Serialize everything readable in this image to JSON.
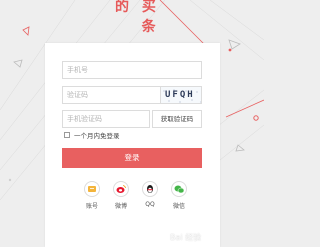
{
  "header": {
    "title_fragment": "的 买\n   条"
  },
  "form": {
    "phone_placeholder": "手机号",
    "code_placeholder": "验证码",
    "captcha_text": "UFQH",
    "sms_placeholder": "手机验证码",
    "sms_button": "获取验证码",
    "remember_label": "一个月内免登录",
    "login_button": "登录"
  },
  "socials": [
    {
      "label": "账号",
      "icon": "account-icon",
      "color": "#f3b43b"
    },
    {
      "label": "微博",
      "icon": "weibo-icon",
      "color": "#e6162d"
    },
    {
      "label": "QQ",
      "icon": "qq-icon",
      "color": "#1d1d1d"
    },
    {
      "label": "微信",
      "icon": "wechat-icon",
      "color": "#44b549"
    }
  ],
  "watermark": "Bai 经验",
  "colors": {
    "accent": "#e86060",
    "header": "#e65a5a",
    "background": "#eeeeee"
  }
}
